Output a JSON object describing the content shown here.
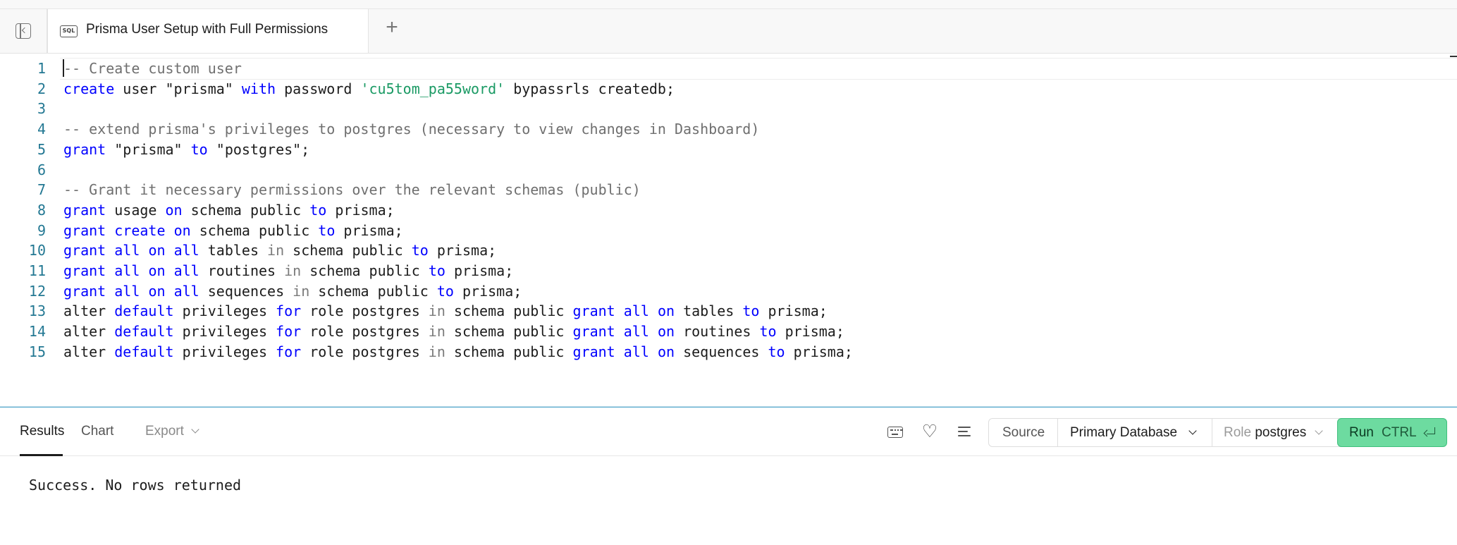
{
  "tabs": {
    "active_title": "Prisma User Setup with Full Permissions",
    "new_tab_symbol": "+"
  },
  "editor": {
    "lines": [
      {
        "num": "1",
        "tokens": [
          [
            "cm",
            "-- Create custom user"
          ]
        ]
      },
      {
        "num": "2",
        "tokens": [
          [
            "kw",
            "create"
          ],
          [
            "",
            " user \"prisma\" "
          ],
          [
            "kw",
            "with"
          ],
          [
            "",
            " password "
          ],
          [
            "str",
            "'cu5tom_pa55word'"
          ],
          [
            "",
            " bypassrls createdb;"
          ]
        ]
      },
      {
        "num": "3",
        "tokens": []
      },
      {
        "num": "4",
        "tokens": [
          [
            "cm",
            "-- extend prisma's privileges to postgres (necessary to view changes in Dashboard)"
          ]
        ]
      },
      {
        "num": "5",
        "tokens": [
          [
            "kw",
            "grant"
          ],
          [
            "",
            " \"prisma\" "
          ],
          [
            "kw",
            "to"
          ],
          [
            "",
            " \"postgres\";"
          ]
        ]
      },
      {
        "num": "6",
        "tokens": []
      },
      {
        "num": "7",
        "tokens": [
          [
            "cm",
            "-- Grant it necessary permissions over the relevant schemas (public)"
          ]
        ]
      },
      {
        "num": "8",
        "tokens": [
          [
            "kw",
            "grant"
          ],
          [
            "",
            " usage "
          ],
          [
            "kw",
            "on"
          ],
          [
            "",
            " schema public "
          ],
          [
            "kw",
            "to"
          ],
          [
            "",
            " prisma;"
          ]
        ]
      },
      {
        "num": "9",
        "tokens": [
          [
            "kw",
            "grant"
          ],
          [
            "",
            " "
          ],
          [
            "kw",
            "create"
          ],
          [
            "",
            " "
          ],
          [
            "kw",
            "on"
          ],
          [
            "",
            " schema public "
          ],
          [
            "kw",
            "to"
          ],
          [
            "",
            " prisma;"
          ]
        ]
      },
      {
        "num": "10",
        "tokens": [
          [
            "kw",
            "grant"
          ],
          [
            "",
            " "
          ],
          [
            "kw",
            "all"
          ],
          [
            "",
            " "
          ],
          [
            "kw",
            "on"
          ],
          [
            "",
            " "
          ],
          [
            "kw",
            "all"
          ],
          [
            "",
            " tables "
          ],
          [
            "op",
            "in"
          ],
          [
            "",
            " schema public "
          ],
          [
            "kw",
            "to"
          ],
          [
            "",
            " prisma;"
          ]
        ]
      },
      {
        "num": "11",
        "tokens": [
          [
            "kw",
            "grant"
          ],
          [
            "",
            " "
          ],
          [
            "kw",
            "all"
          ],
          [
            "",
            " "
          ],
          [
            "kw",
            "on"
          ],
          [
            "",
            " "
          ],
          [
            "kw",
            "all"
          ],
          [
            "",
            " routines "
          ],
          [
            "op",
            "in"
          ],
          [
            "",
            " schema public "
          ],
          [
            "kw",
            "to"
          ],
          [
            "",
            " prisma;"
          ]
        ]
      },
      {
        "num": "12",
        "tokens": [
          [
            "kw",
            "grant"
          ],
          [
            "",
            " "
          ],
          [
            "kw",
            "all"
          ],
          [
            "",
            " "
          ],
          [
            "kw",
            "on"
          ],
          [
            "",
            " "
          ],
          [
            "kw",
            "all"
          ],
          [
            "",
            " sequences "
          ],
          [
            "op",
            "in"
          ],
          [
            "",
            " schema public "
          ],
          [
            "kw",
            "to"
          ],
          [
            "",
            " prisma;"
          ]
        ]
      },
      {
        "num": "13",
        "tokens": [
          [
            "",
            "alter "
          ],
          [
            "kw",
            "default"
          ],
          [
            "",
            " privileges "
          ],
          [
            "kw",
            "for"
          ],
          [
            "",
            " role postgres "
          ],
          [
            "op",
            "in"
          ],
          [
            "",
            " schema public "
          ],
          [
            "kw",
            "grant"
          ],
          [
            "",
            " "
          ],
          [
            "kw",
            "all"
          ],
          [
            "",
            " "
          ],
          [
            "kw",
            "on"
          ],
          [
            "",
            " tables "
          ],
          [
            "kw",
            "to"
          ],
          [
            "",
            " prisma;"
          ]
        ]
      },
      {
        "num": "14",
        "tokens": [
          [
            "",
            "alter "
          ],
          [
            "kw",
            "default"
          ],
          [
            "",
            " privileges "
          ],
          [
            "kw",
            "for"
          ],
          [
            "",
            " role postgres "
          ],
          [
            "op",
            "in"
          ],
          [
            "",
            " schema public "
          ],
          [
            "kw",
            "grant"
          ],
          [
            "",
            " "
          ],
          [
            "kw",
            "all"
          ],
          [
            "",
            " "
          ],
          [
            "kw",
            "on"
          ],
          [
            "",
            " routines "
          ],
          [
            "kw",
            "to"
          ],
          [
            "",
            " prisma;"
          ]
        ]
      },
      {
        "num": "15",
        "tokens": [
          [
            "",
            "alter "
          ],
          [
            "kw",
            "default"
          ],
          [
            "",
            " privileges "
          ],
          [
            "kw",
            "for"
          ],
          [
            "",
            " role postgres "
          ],
          [
            "op",
            "in"
          ],
          [
            "",
            " schema public "
          ],
          [
            "kw",
            "grant"
          ],
          [
            "",
            " "
          ],
          [
            "kw",
            "all"
          ],
          [
            "",
            " "
          ],
          [
            "kw",
            "on"
          ],
          [
            "",
            " sequences "
          ],
          [
            "kw",
            "to"
          ],
          [
            "",
            " prisma;"
          ]
        ]
      }
    ]
  },
  "results": {
    "tabs": {
      "results": "Results",
      "chart": "Chart",
      "export": "Export"
    },
    "source_label": "Source",
    "database": "Primary Database",
    "role_label": "Role",
    "role_value": "postgres",
    "run_label": "Run",
    "run_shortcut": "CTRL",
    "message": "Success. No rows returned"
  },
  "colors": {
    "keyword": "#0000ff",
    "comment": "#6f6f6f",
    "string": "#1a9a64",
    "line_number": "#237893",
    "run_button": "#6ddba0"
  }
}
